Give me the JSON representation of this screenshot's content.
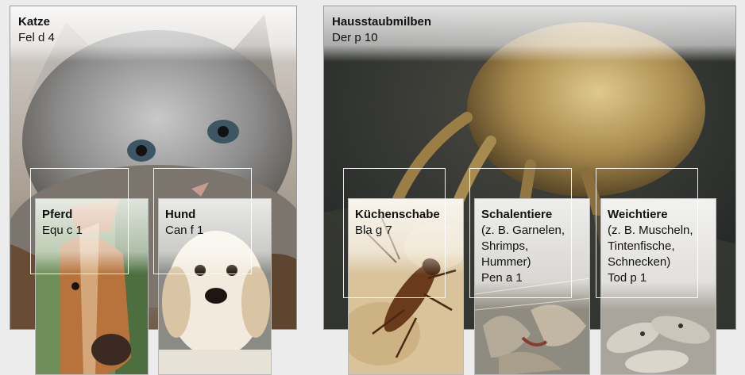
{
  "katze": {
    "title": "Katze",
    "code": "Fel d 4"
  },
  "milben": {
    "title": "Hausstaubmilben",
    "code": "Der p 10"
  },
  "pferd": {
    "title": "Pferd",
    "code": "Equ c 1"
  },
  "hund": {
    "title": "Hund",
    "code": "Can f 1"
  },
  "kuechenschabe": {
    "title": "Küchenschabe",
    "code": "Bla g 7"
  },
  "schalentiere": {
    "title": "Schalentiere",
    "detail": "(z. B. Garnelen,\nShrimps,\nHummer)",
    "code": "Pen a 1"
  },
  "weichtiere": {
    "title": "Weichtiere",
    "detail": "(z. B. Muscheln,\nTintenfische,\nSchnecken)",
    "code": "Tod p 1"
  }
}
